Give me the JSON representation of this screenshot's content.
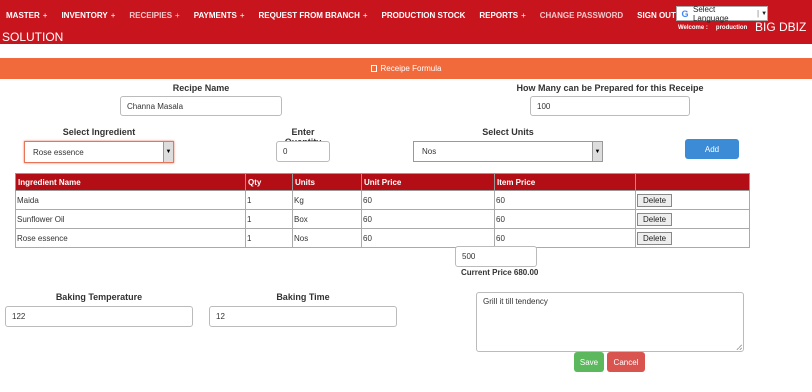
{
  "nav": {
    "items": [
      {
        "label": "MASTER",
        "has_plus": true
      },
      {
        "label": "INVENTORY",
        "has_plus": true
      },
      {
        "label": "RECEIPIES",
        "has_plus": true
      },
      {
        "label": "PAYMENTS",
        "has_plus": true
      },
      {
        "label": "REQUEST FROM BRANCH",
        "has_plus": true
      },
      {
        "label": "PRODUCTION STOCK",
        "has_plus": false
      },
      {
        "label": "REPORTS",
        "has_plus": true
      },
      {
        "label": "CHANGE PASSWORD",
        "has_plus": false
      },
      {
        "label": "SIGN OUT",
        "has_plus": false
      }
    ],
    "plus": "+",
    "language_select": "Select Language",
    "language_arrow": "▼",
    "language_separator": "|",
    "welcome_label": "Welcome :",
    "welcome_user": "production",
    "brand_part1": "BIG DBIZ",
    "brand_part2": "SOLUTION"
  },
  "formula_bar": {
    "label": "Receipe Formula"
  },
  "form": {
    "recipe_name_label": "Recipe Name",
    "recipe_name_value": "Channa Masala",
    "prepared_label": "How Many can be Prepared for this Receipe",
    "prepared_value": "100",
    "ingredient_label": "Select Ingredient",
    "ingredient_value": "Rose essence",
    "quantity_label": "Enter Quantity",
    "quantity_value": "0",
    "units_label": "Select Units",
    "units_value": "Nos",
    "add_button": "Add"
  },
  "table": {
    "headers": [
      "Ingredient Name",
      "Qty",
      "Units",
      "Unit Price",
      "Item Price",
      ""
    ],
    "rows": [
      {
        "name": "Maida",
        "qty": "1",
        "units": "Kg",
        "unit_price": "60",
        "item_price": "60",
        "action": "Delete"
      },
      {
        "name": "Sunflower Oil",
        "qty": "1",
        "units": "Box",
        "unit_price": "60",
        "item_price": "60",
        "action": "Delete"
      },
      {
        "name": "Rose essence",
        "qty": "1",
        "units": "Nos",
        "unit_price": "60",
        "item_price": "60",
        "action": "Delete"
      }
    ]
  },
  "pricing": {
    "total_value": "500",
    "current_price_text": "Current Price 680.00"
  },
  "baking": {
    "temperature_label": "Baking Temperature",
    "temperature_value": "122",
    "time_label": "Baking Time",
    "time_value": "12",
    "notes_value": "Grill it till tendency"
  },
  "actions": {
    "save": "Save",
    "cancel": "Cancel"
  },
  "colors": {
    "header_red": "#c8151d",
    "formula_orange": "#f06a3c",
    "table_header": "#b30e15",
    "add_blue": "#3c8bd7",
    "save_green": "#5cb85c",
    "cancel_red": "#d9534f"
  },
  "icons": {
    "formula": "file-icon",
    "google": "google-g-icon"
  }
}
